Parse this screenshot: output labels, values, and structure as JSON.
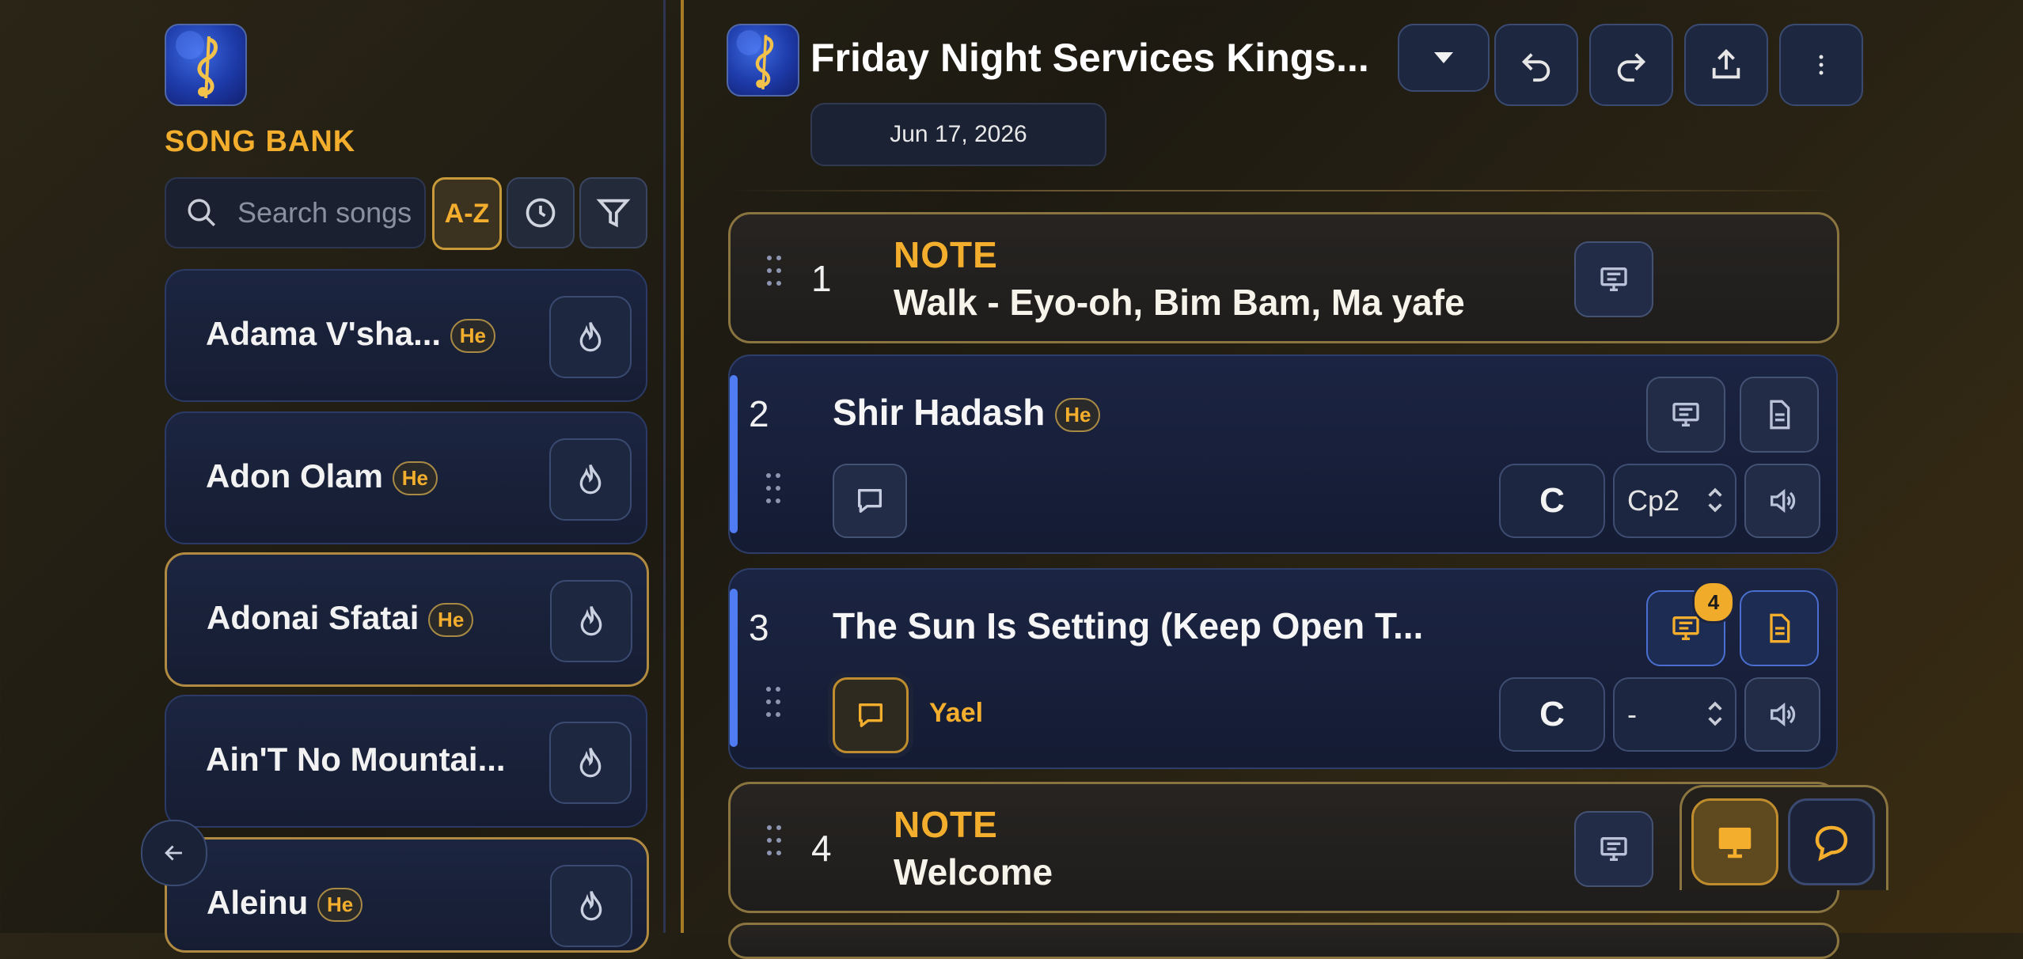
{
  "sidebar": {
    "title": "SONG BANK",
    "search_placeholder": "Search songs",
    "sort_label": "A-Z",
    "songs": [
      {
        "title": "Adama V'sha...",
        "lang": "He"
      },
      {
        "title": "Adon Olam",
        "lang": "He"
      },
      {
        "title": "Adonai Sfatai",
        "lang": "He",
        "selected": true
      },
      {
        "title": "Ain'T No Mountai...",
        "lang": ""
      },
      {
        "title": "Aleinu",
        "lang": "He"
      }
    ]
  },
  "header": {
    "title": "Friday Night Services Kings...",
    "date": "Jun 17, 2026"
  },
  "setlist": [
    {
      "number": "1",
      "type": "note",
      "label": "NOTE",
      "text": "Walk - Eyo-oh, Bim Bam, Ma yafe"
    },
    {
      "number": "2",
      "type": "song",
      "title": "Shir Hadash",
      "lang": "He",
      "key": "C",
      "capo": "Cp2"
    },
    {
      "number": "3",
      "type": "song",
      "title": "The Sun Is Setting (Keep Open T...",
      "slide_count": "4",
      "comment_name": "Yael",
      "key": "C",
      "capo": "-"
    },
    {
      "number": "4",
      "type": "note",
      "label": "NOTE",
      "text": "Welcome"
    }
  ],
  "colors": {
    "accent": "#f3ae2d",
    "active_blue": "#4f7cf2",
    "panel": "#1b2442"
  },
  "icons": [
    "app-logo-icon",
    "search-icon",
    "clock-icon",
    "filter-icon",
    "flame-icon",
    "arrow-left-icon",
    "chevron-down-icon",
    "undo-icon",
    "redo-icon",
    "share-icon",
    "more-vertical-icon",
    "drag-handle-icon",
    "presentation-icon",
    "document-icon",
    "comment-icon",
    "speaker-icon",
    "monitor-icon"
  ]
}
